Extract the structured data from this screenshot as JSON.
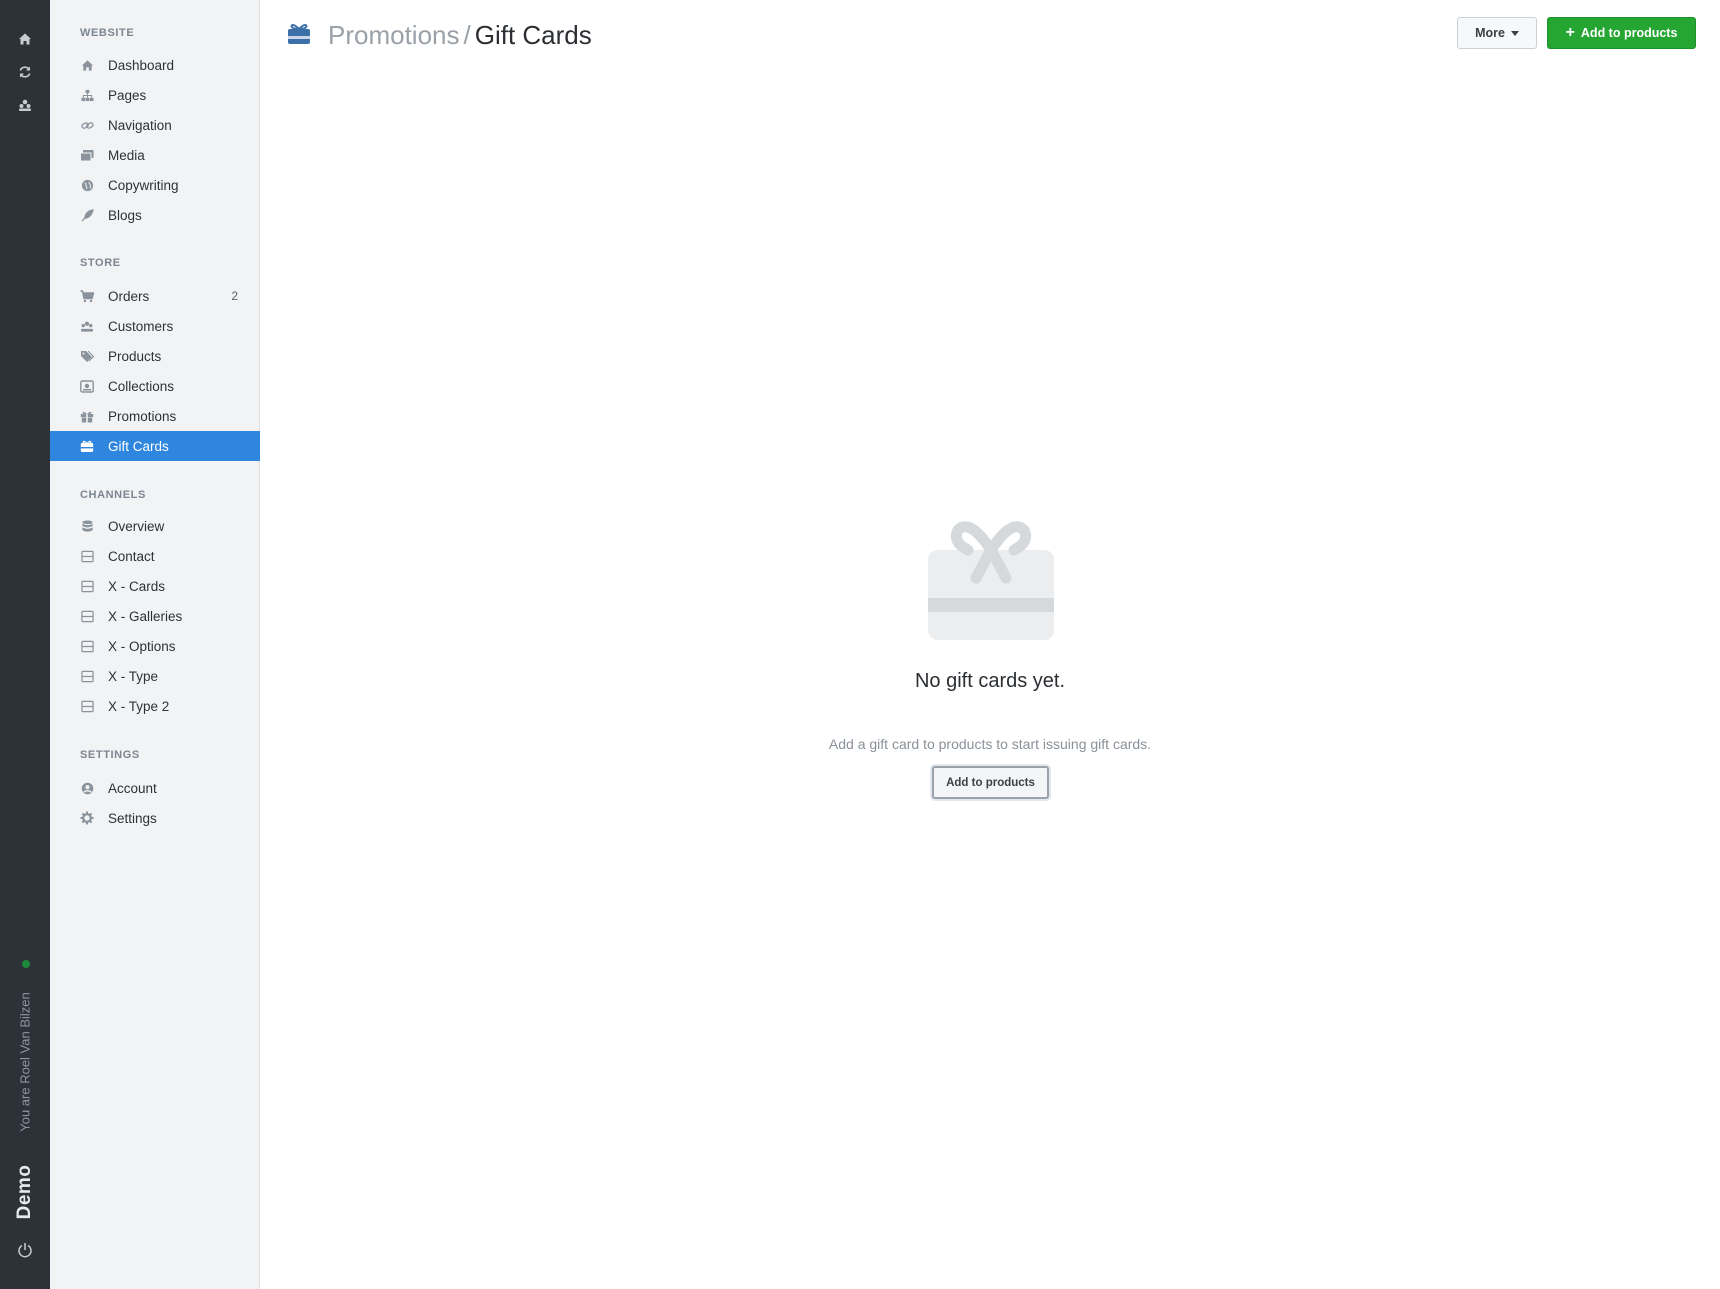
{
  "rail": {
    "icons": [
      "home-icon",
      "refresh-icon",
      "users-icon",
      "power-icon"
    ],
    "user_text": "You are Roel Van Bilzen",
    "brand": "Demo",
    "status_color": "#1f8a3b"
  },
  "sidebar": {
    "sections": [
      {
        "title": "WEBSITE",
        "items": [
          {
            "label": "Dashboard",
            "icon": "home-icon"
          },
          {
            "label": "Pages",
            "icon": "sitemap-icon"
          },
          {
            "label": "Navigation",
            "icon": "link-icon"
          },
          {
            "label": "Media",
            "icon": "images-icon"
          },
          {
            "label": "Copywriting",
            "icon": "globe-icon"
          },
          {
            "label": "Blogs",
            "icon": "feather-icon"
          }
        ]
      },
      {
        "title": "STORE",
        "items": [
          {
            "label": "Orders",
            "icon": "cart-icon",
            "badge": "2"
          },
          {
            "label": "Customers",
            "icon": "users-icon"
          },
          {
            "label": "Products",
            "icon": "tags-icon"
          },
          {
            "label": "Collections",
            "icon": "collection-icon"
          },
          {
            "label": "Promotions",
            "icon": "gift-icon"
          },
          {
            "label": "Gift Cards",
            "icon": "gift-card-icon",
            "active": true
          }
        ]
      },
      {
        "title": "CHANNELS",
        "items": [
          {
            "label": "Overview",
            "icon": "database-icon"
          },
          {
            "label": "Contact",
            "icon": "form-icon"
          },
          {
            "label": "X - Cards",
            "icon": "form-icon"
          },
          {
            "label": "X - Galleries",
            "icon": "form-icon"
          },
          {
            "label": "X - Options",
            "icon": "form-icon"
          },
          {
            "label": "X - Type",
            "icon": "form-icon"
          },
          {
            "label": "X - Type 2",
            "icon": "form-icon"
          }
        ]
      },
      {
        "title": "SETTINGS",
        "items": [
          {
            "label": "Account",
            "icon": "user-circle-icon"
          },
          {
            "label": "Settings",
            "icon": "gear-icon"
          }
        ]
      }
    ]
  },
  "header": {
    "icon": "gift-card-icon",
    "breadcrumb_parent": "Promotions",
    "breadcrumb_sep": "/",
    "title": "Gift Cards",
    "more_label": "More",
    "add_label": "Add to products"
  },
  "empty_state": {
    "icon": "gift-icon",
    "title": "No gift cards yet.",
    "subtitle": "Add a gift card to products to start issuing gift cards.",
    "button_label": "Add to products"
  },
  "colors": {
    "accent": "#2f86de",
    "primary_button": "#25a531",
    "rail": "#2d3238",
    "sidebar": "#f1f3f5"
  }
}
